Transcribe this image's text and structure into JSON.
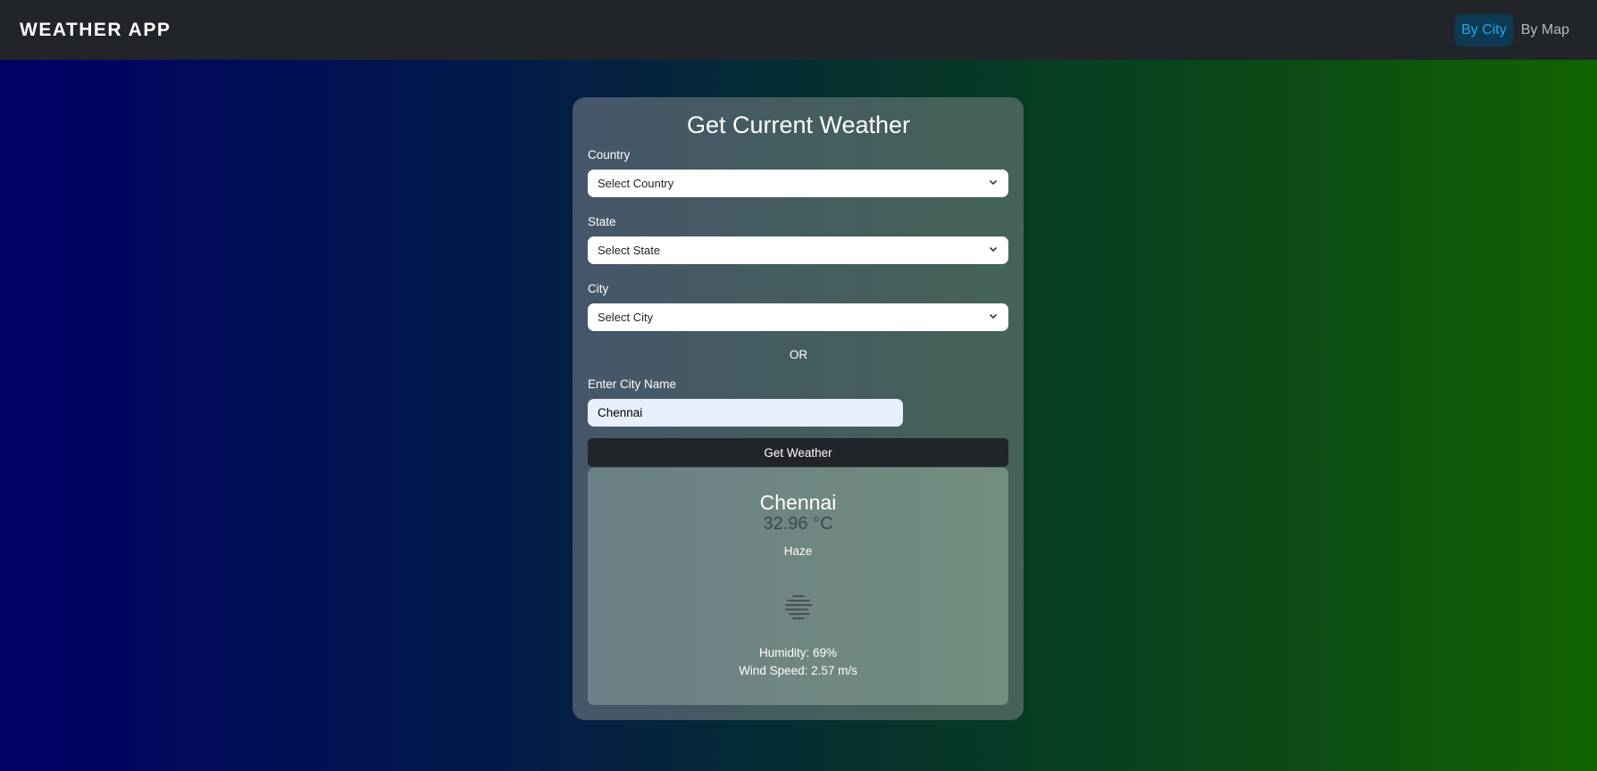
{
  "navbar": {
    "brand": "WEATHER APP",
    "links": [
      {
        "label": "By City",
        "active": true
      },
      {
        "label": "By Map",
        "active": false
      }
    ],
    "active_color": "#1ea7e8"
  },
  "form": {
    "title": "Get Current Weather",
    "country": {
      "label": "Country",
      "value": "Select Country"
    },
    "state": {
      "label": "State",
      "value": "Select State"
    },
    "city": {
      "label": "City",
      "value": "Select City"
    },
    "or_text": "OR",
    "city_name": {
      "label": "Enter City Name",
      "value": "Chennai"
    },
    "submit_label": "Get Weather"
  },
  "result": {
    "city": "Chennai",
    "temperature": "32.96 °C",
    "description": "Haze",
    "icon": "haze-icon",
    "humidity": "Humidity: 69%",
    "wind_speed": "Wind Speed: 2.57 m/s"
  }
}
